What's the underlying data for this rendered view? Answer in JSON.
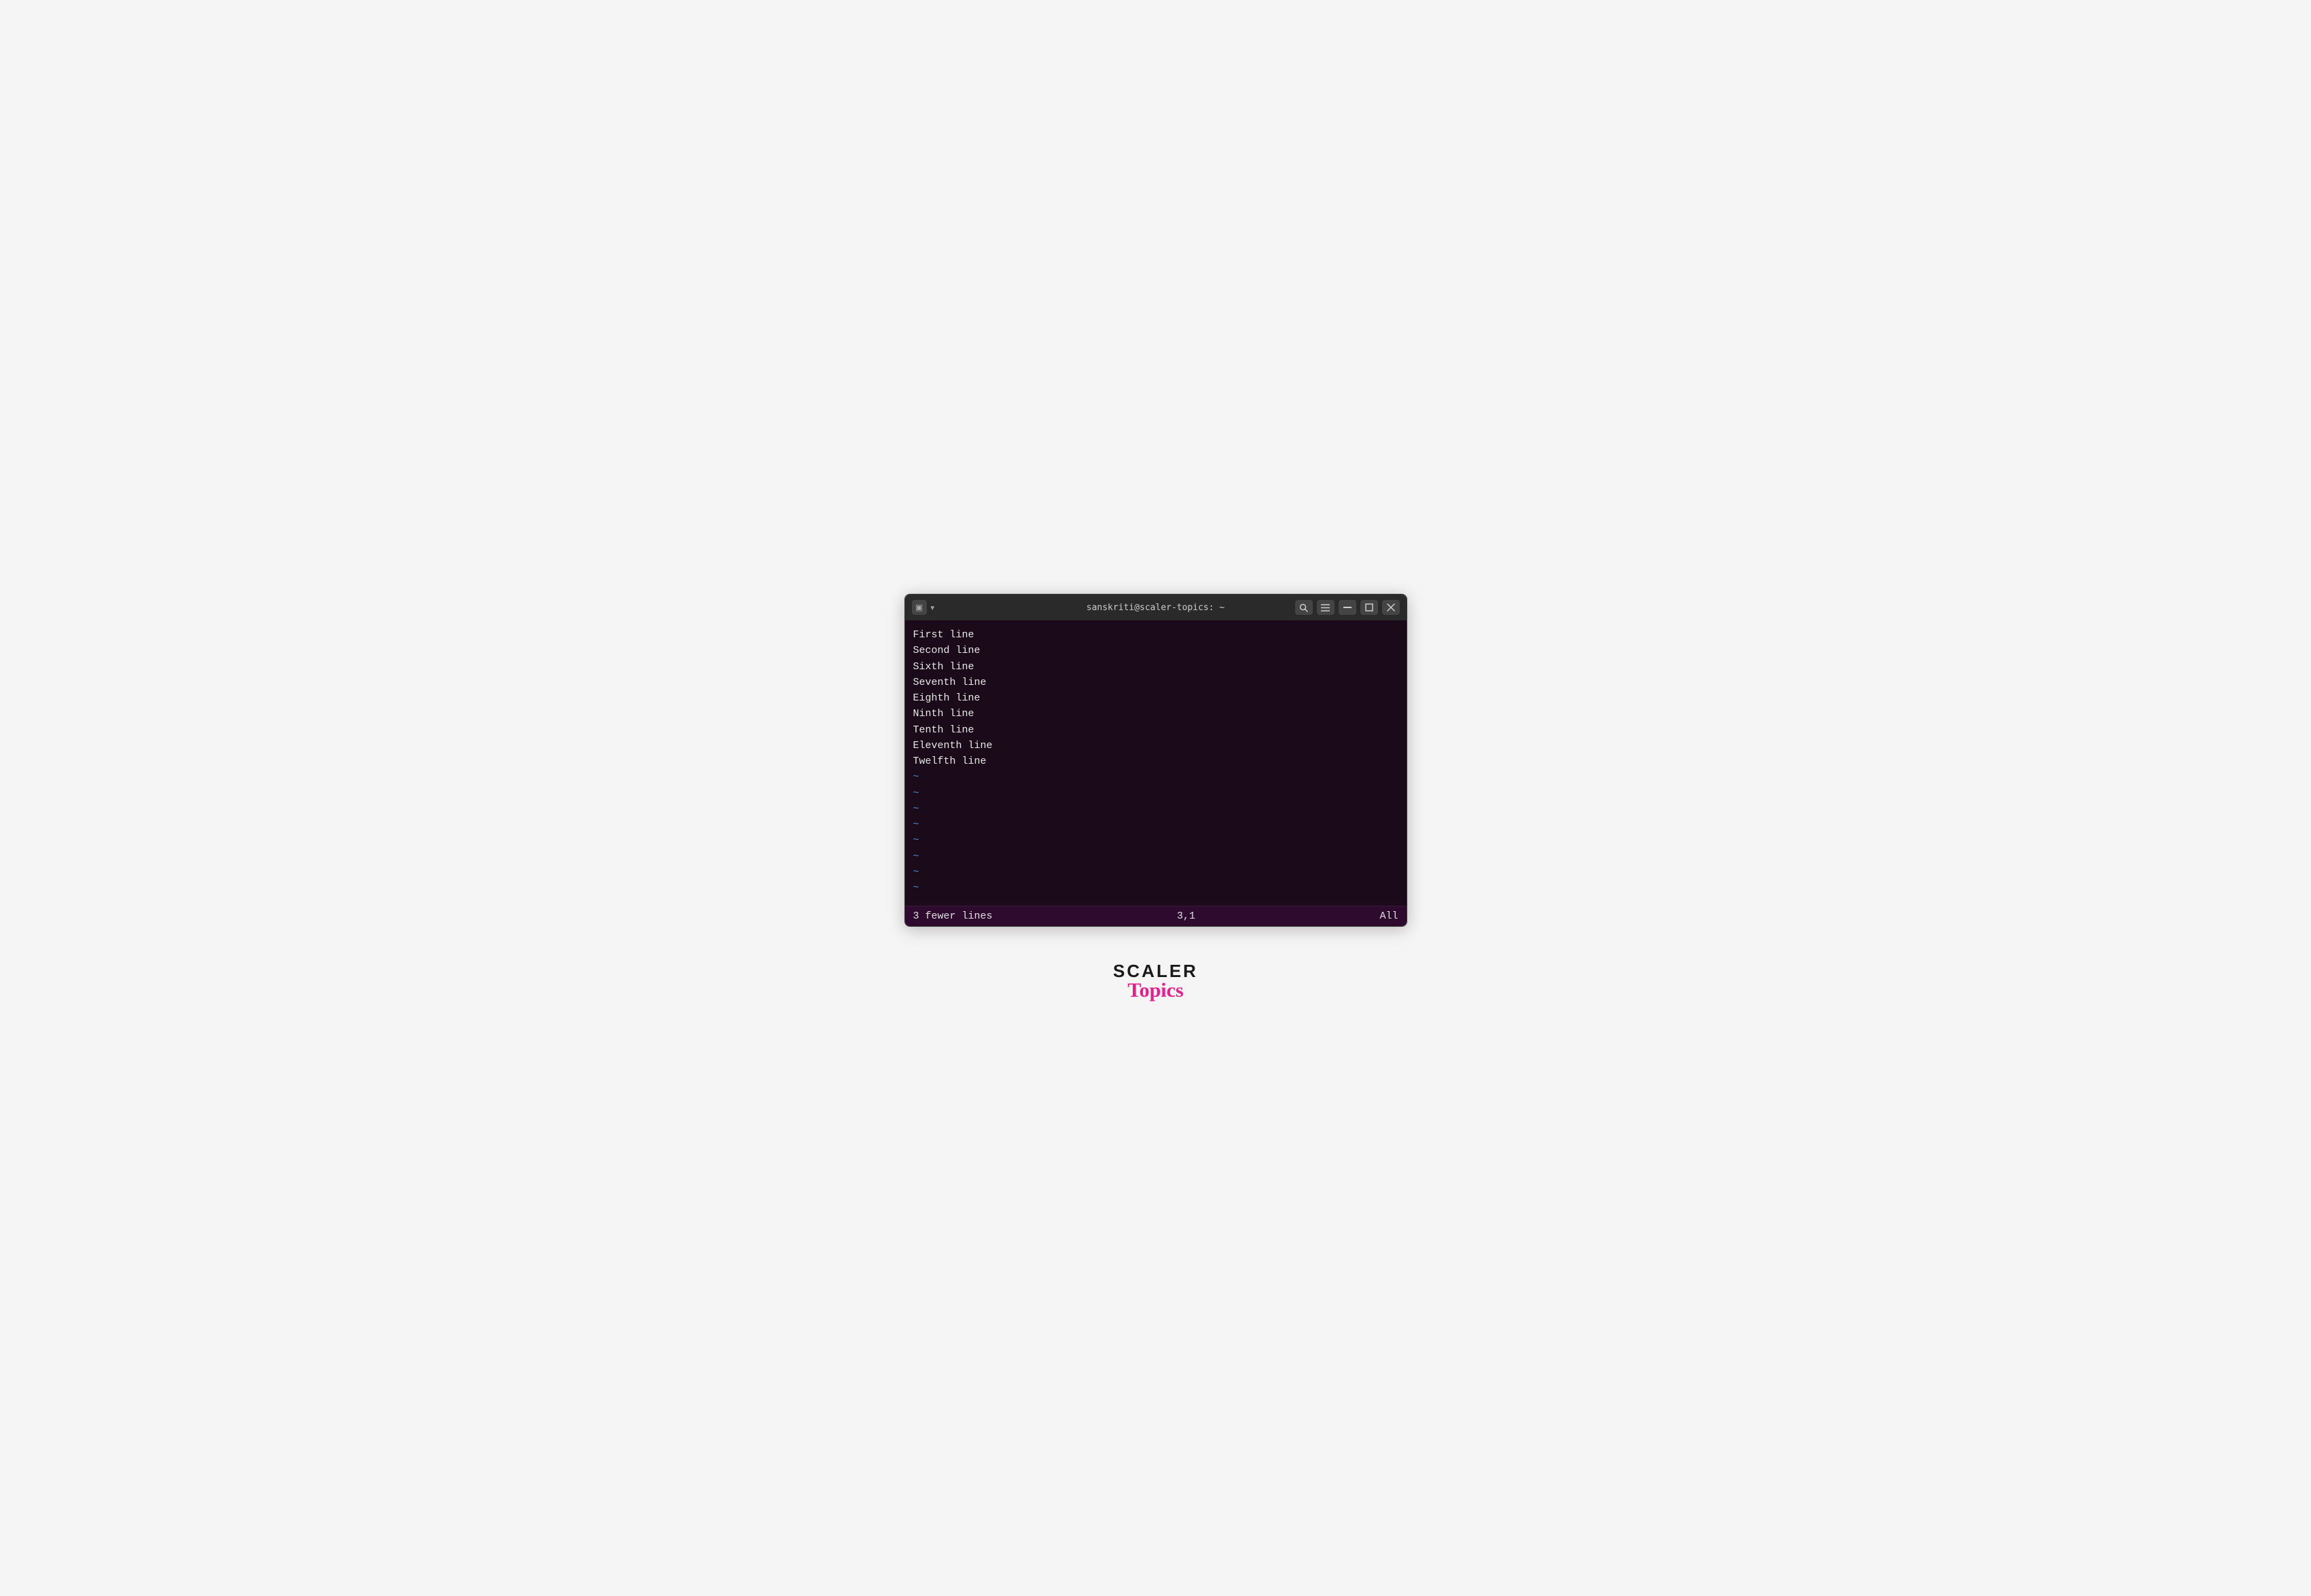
{
  "terminal": {
    "titlebar": {
      "title": "sanskriti@scaler-topics: ~",
      "icon_label": "▣",
      "chevron": "▾",
      "search_btn": "🔍",
      "menu_btn": "☰",
      "minimize_btn": "—",
      "maximize_btn": "□",
      "close_btn": "✕"
    },
    "content": {
      "lines": [
        "First line",
        "Second line",
        "Sixth line",
        "Seventh line",
        "Eighth line",
        "Ninth line",
        "Tenth line",
        "Eleventh line",
        "Twelfth line"
      ],
      "tildes": [
        "~",
        "~",
        "~",
        "~",
        "~",
        "~",
        "~",
        "~"
      ]
    },
    "statusbar": {
      "left": "3 fewer lines",
      "middle": "3,1",
      "right": "All"
    }
  },
  "logo": {
    "scaler": "SCALER",
    "topics": "Topics"
  }
}
